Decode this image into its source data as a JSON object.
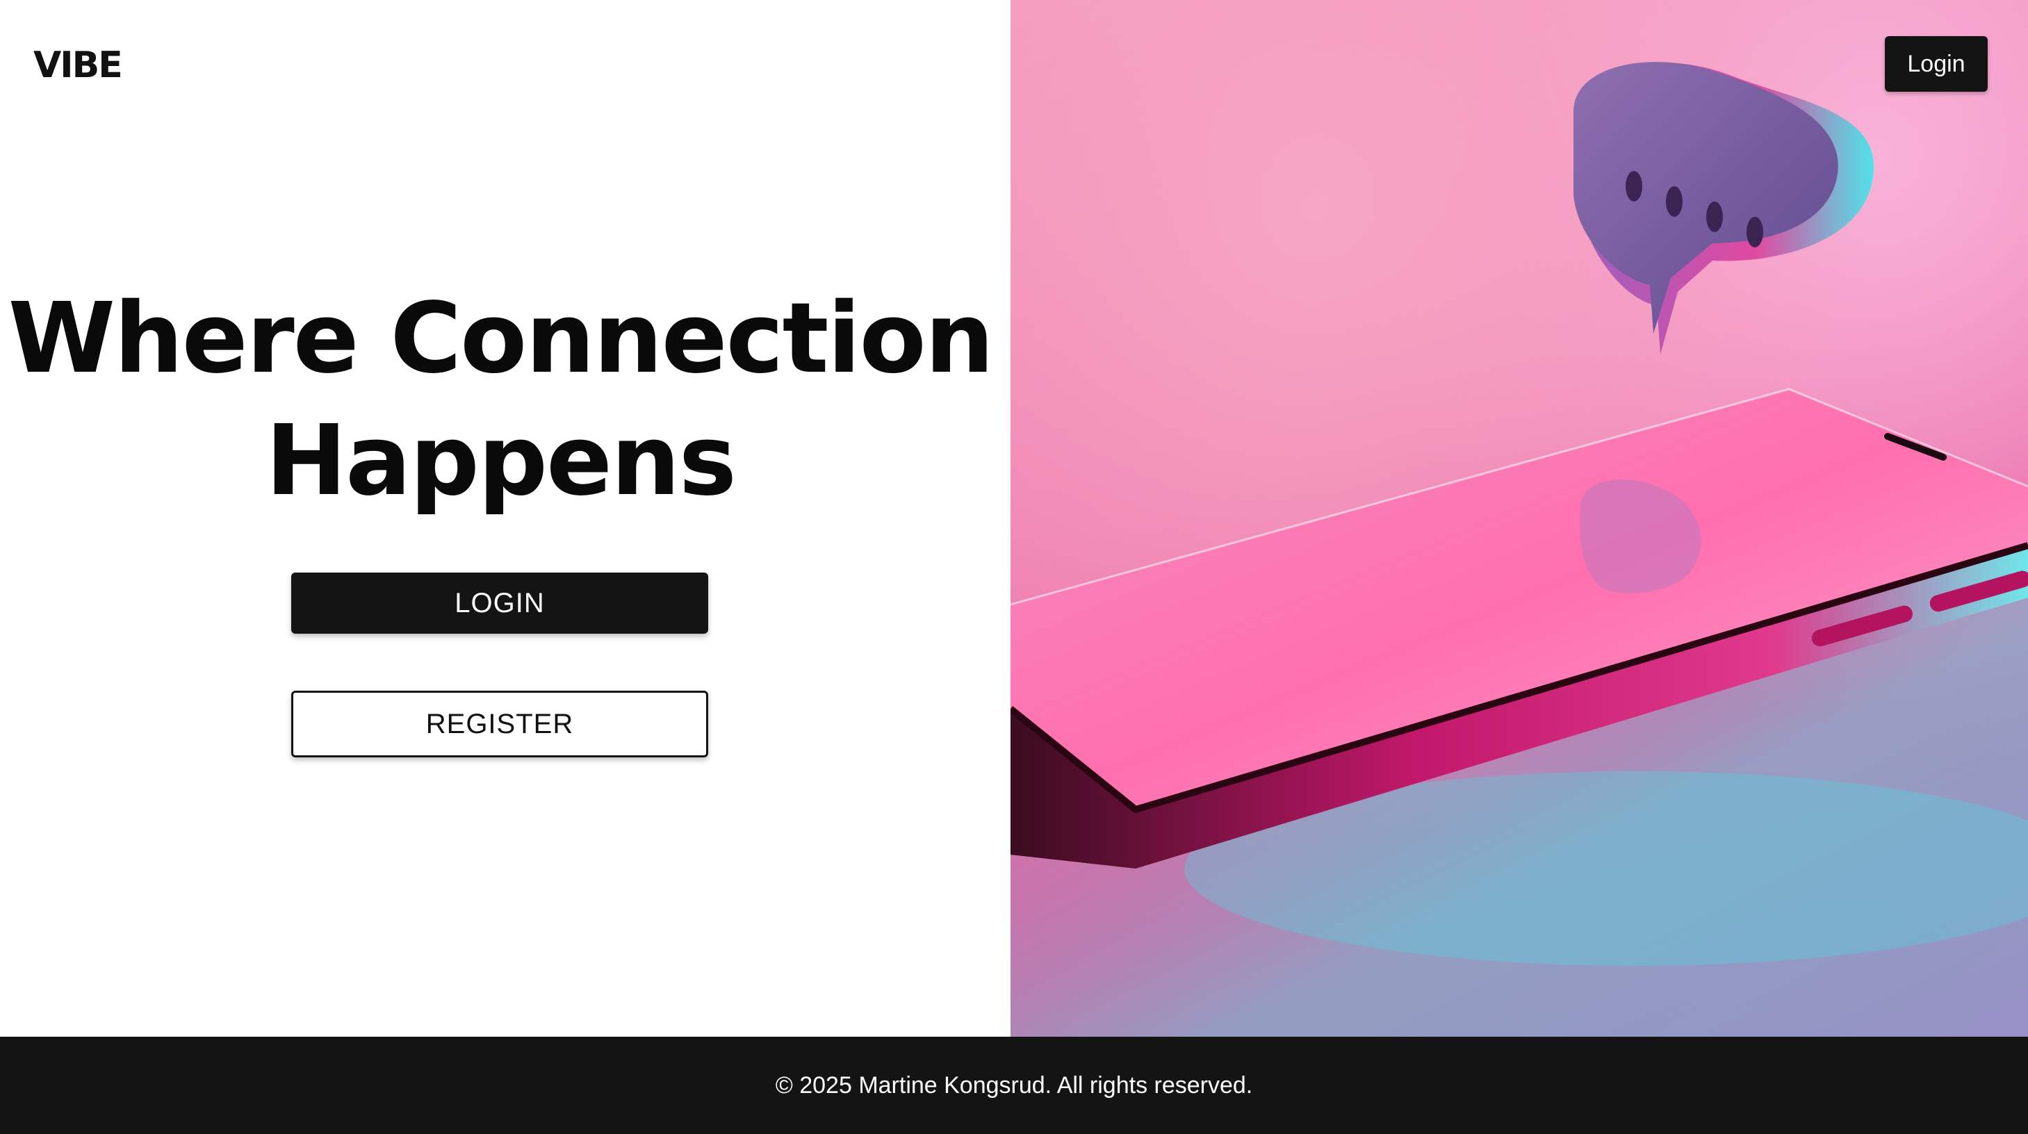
{
  "header": {
    "logo_text": "VIBE",
    "login_label": "Login"
  },
  "hero": {
    "headline_line1": "Where Connection",
    "headline_line2": "Happens",
    "login_button_label": "LOGIN",
    "register_button_label": "REGISTER"
  },
  "image": {
    "subject": "smartphone-with-chat-bubble",
    "icons": [
      "chat-bubble-icon"
    ]
  },
  "footer": {
    "copyright": "© 2025 Martine Kongsrud. All rights reserved."
  },
  "colors": {
    "primary_dark": "#141414",
    "background": "#ffffff",
    "accent_pink": "#ee7fb0",
    "accent_cyan": "#4fe3e8"
  }
}
